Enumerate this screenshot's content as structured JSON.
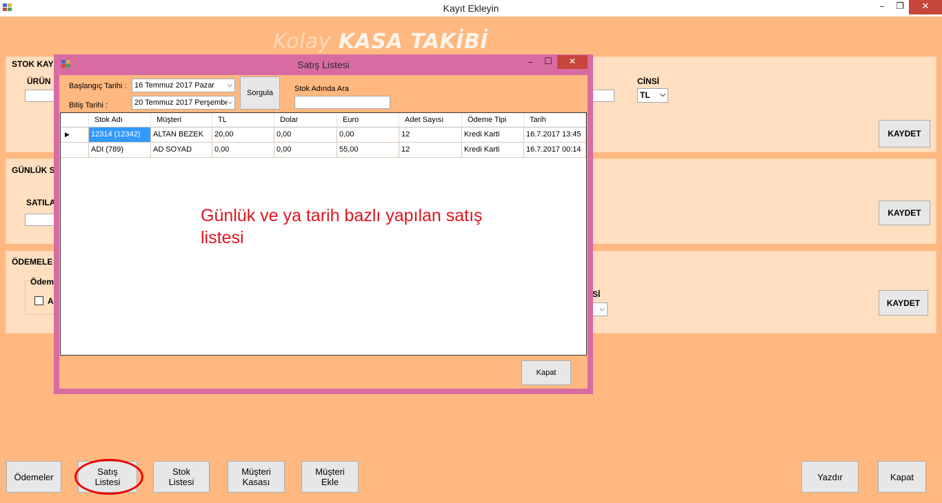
{
  "window": {
    "title": "Kayıt Ekleyin",
    "minimize": "–",
    "maximize": "❐",
    "close": "✕"
  },
  "banner": {
    "light": "Kolay",
    "bold": "KASA TAKİBİ"
  },
  "stok_group": {
    "title": "STOK KAY",
    "urun_label": "ÜRÜN",
    "cinsi_label": "CİNSİ",
    "cinsi_value": "TL",
    "save": "KAYDET"
  },
  "gunluk_group": {
    "title": "GÜNLÜK S",
    "satila_label": "SATILA",
    "save": "KAYDET"
  },
  "odemeler_group": {
    "title": "ÖDEMELE",
    "odeme_label": "Ödeme",
    "check_label": "A",
    "si_label": "Sİ",
    "save": "KAYDET"
  },
  "dialog": {
    "title": "Satış Listesi",
    "minimize": "–",
    "maximize": "☐",
    "close": "✕",
    "start_label": "Başlangıç Tarihi :",
    "start_value": "16 Temmuz 2017    Pazar",
    "end_label": "Bitiş Tarihi :",
    "end_value": "20 Temmuz 2017 Perşembe",
    "query_button": "Sorgula",
    "search_label": "Stok Adında Ara",
    "search_value": "",
    "columns": [
      "Stok Adı",
      "Müşteri",
      "TL",
      "Dolar",
      "Euro",
      "Adet Sayısı",
      "Ödeme Tipi",
      "Tarih"
    ],
    "rows": [
      [
        "12314 (12342)",
        "ALTAN BEZEK",
        "20,00",
        "0,00",
        "0,00",
        "12",
        "Kredi Karti",
        "16.7.2017 13:45"
      ],
      [
        "ADI (789)",
        "AD SOYAD",
        "0,00",
        "0,00",
        "55,00",
        "12",
        "Kredi Karti",
        "16.7.2017 00:14"
      ]
    ],
    "close_button": "Kapat"
  },
  "annotation": {
    "line1": "Günlük ve ya tarih bazlı yapılan satış",
    "line2": "listesi"
  },
  "bottom_buttons": {
    "odemeler": "Ödemeler",
    "satis_1": "Satış",
    "satis_2": "Listesi",
    "stok_1": "Stok",
    "stok_2": "Listesi",
    "musteri_kasasi_1": "Müşteri",
    "musteri_kasasi_2": "Kasası",
    "musteri_ekle_1": "Müşteri",
    "musteri_ekle_2": "Ekle",
    "yazdir": "Yazdır",
    "kapat": "Kapat"
  }
}
